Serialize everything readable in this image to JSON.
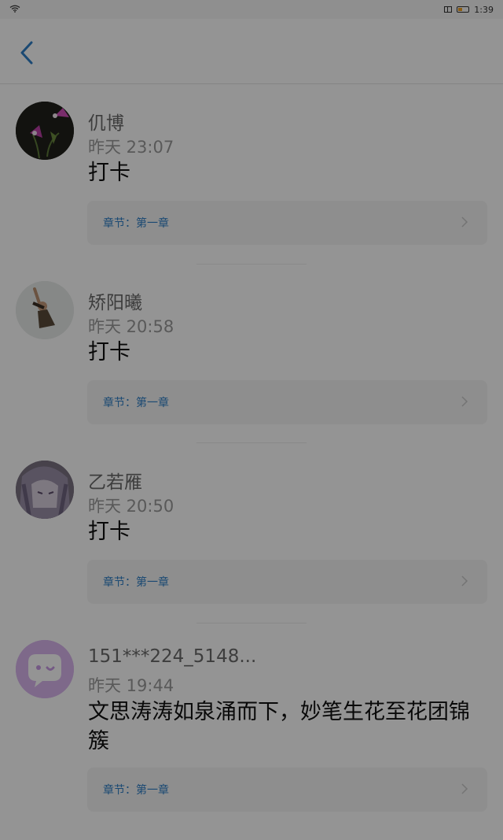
{
  "status_bar": {
    "time": "1:39"
  },
  "header": {
    "back_icon": "chevron-left-icon",
    "accent_color": "#2f7fc6"
  },
  "comments": [
    {
      "username": "仉博",
      "time": "昨天 23:07",
      "content": "打卡",
      "chapter": "章节：第一章",
      "avatar": "flower-photo"
    },
    {
      "username": "矫阳曦",
      "time": "昨天 20:58",
      "content": "打卡",
      "chapter": "章节：第一章",
      "avatar": "person-photo"
    },
    {
      "username": "乙若雁",
      "time": "昨天 20:50",
      "content": "打卡",
      "chapter": "章节：第一章",
      "avatar": "anime-photo"
    },
    {
      "username": "151***224_5148...",
      "time": "昨天 19:44",
      "content": "文思涛涛如泉涌而下，妙笔生花至花团锦簇",
      "chapter": "章节：第一章",
      "avatar": "default-chat-avatar"
    }
  ],
  "overlay_color": "#000000"
}
